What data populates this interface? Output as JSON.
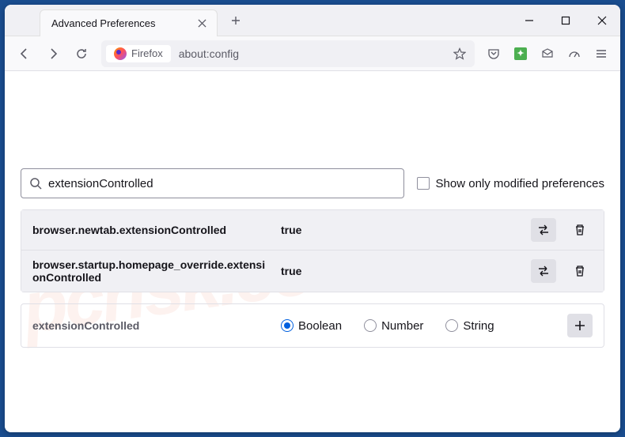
{
  "window": {
    "tab_title": "Advanced Preferences"
  },
  "urlbar": {
    "identity": "Firefox",
    "url": "about:config"
  },
  "search": {
    "value": "extensionControlled",
    "checkbox_label": "Show only modified preferences"
  },
  "prefs": [
    {
      "name": "browser.newtab.extensionControlled",
      "value": "true"
    },
    {
      "name": "browser.startup.homepage_override.extensionControlled",
      "value": "true"
    }
  ],
  "new_pref": {
    "name": "extensionControlled",
    "types": {
      "boolean": "Boolean",
      "number": "Number",
      "string": "String"
    },
    "selected": "boolean"
  },
  "watermark": "pcrisk.com"
}
